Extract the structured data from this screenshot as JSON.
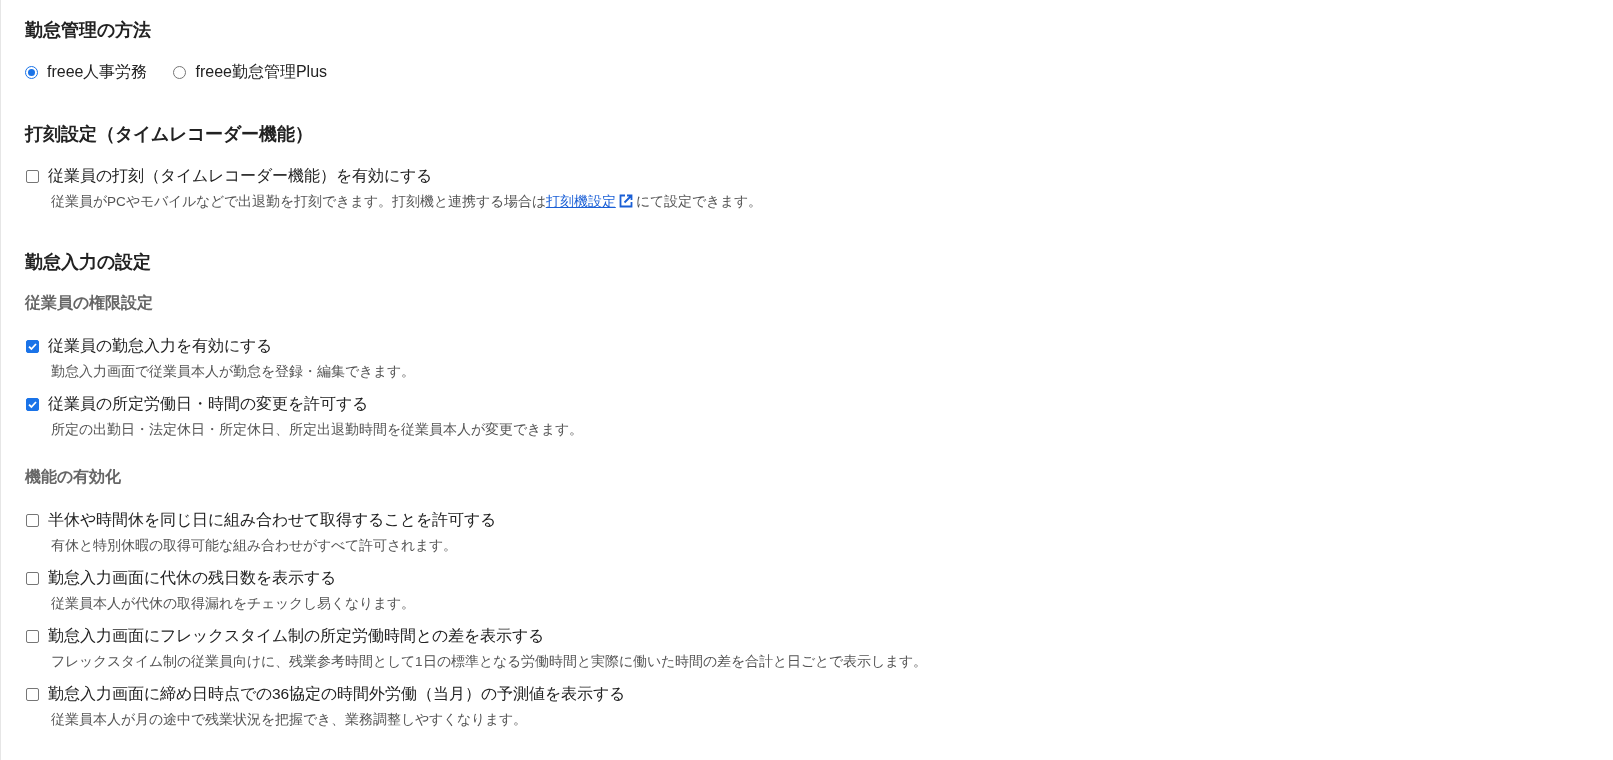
{
  "sections": [
    {
      "kind": "radio",
      "title": "勤怠管理の方法",
      "options": [
        {
          "label": "freee人事労務",
          "selected": true
        },
        {
          "label": "freee勤怠管理Plus",
          "selected": false
        }
      ]
    },
    {
      "kind": "checklist",
      "title": "打刻設定（タイムレコーダー機能）",
      "groups": [
        {
          "items": [
            {
              "label": "従業員の打刻（タイムレコーダー機能）を有効にする",
              "checked": false,
              "description": "従業員がPCやモバイルなどで出退勤を打刻できます。打刻機と連携する場合は",
              "link": {
                "text": "打刻機設定"
              },
              "description_end": "にて設定できます。"
            }
          ]
        }
      ]
    },
    {
      "kind": "checklist",
      "title": "勤怠入力の設定",
      "groups": [
        {
          "subtitle": "従業員の権限設定",
          "items": [
            {
              "label": "従業員の勤怠入力を有効にする",
              "checked": true,
              "description": "勤怠入力画面で従業員本人が勤怠を登録・編集できます。"
            },
            {
              "label": "従業員の所定労働日・時間の変更を許可する",
              "checked": true,
              "description": "所定の出勤日・法定休日・所定休日、所定出退勤時間を従業員本人が変更できます。"
            }
          ]
        },
        {
          "subtitle": "機能の有効化",
          "items": [
            {
              "label": "半休や時間休を同じ日に組み合わせて取得することを許可する",
              "checked": false,
              "description": "有休と特別休暇の取得可能な組み合わせがすべて許可されます。"
            },
            {
              "label": "勤怠入力画面に代休の残日数を表示する",
              "checked": false,
              "description": "従業員本人が代休の取得漏れをチェックし易くなります。"
            },
            {
              "label": "勤怠入力画面にフレックスタイム制の所定労働時間との差を表示する",
              "checked": false,
              "description": "フレックスタイム制の従業員向けに、残業参考時間として1日の標準となる労働時間と実際に働いた時間の差を合計と日ごとで表示します。"
            },
            {
              "label": "勤怠入力画面に締め日時点での36協定の時間外労働（当月）の予測値を表示する",
              "checked": false,
              "description": "従業員本人が月の途中で残業状況を把握でき、業務調整しやすくなります。"
            }
          ]
        }
      ]
    }
  ]
}
